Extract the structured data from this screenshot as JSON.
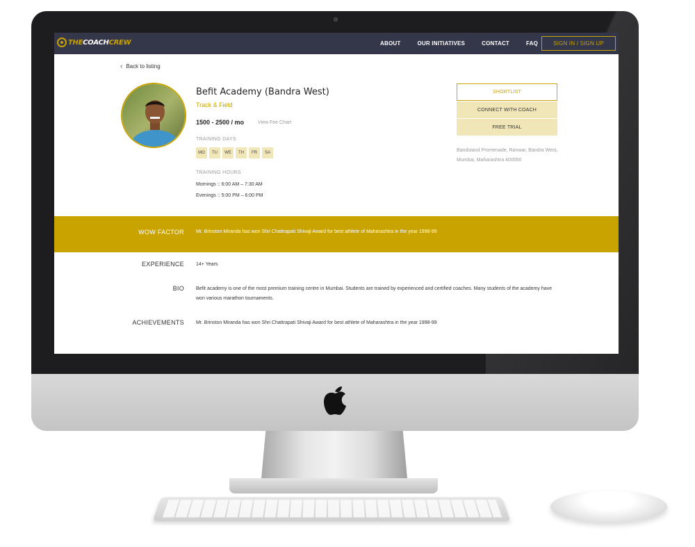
{
  "nav": {
    "logo_part1": "THE",
    "logo_part2": "COACH",
    "logo_part3": "CREW",
    "links": [
      "ABOUT",
      "OUR INITIATIVES",
      "CONTACT",
      "FAQ"
    ],
    "signin_label": "SIGN IN / SIGN UP"
  },
  "back_label": "Back to listing",
  "coach": {
    "title": "Befit Academy (Bandra West)",
    "sport": "Track & Field",
    "fee": "1500 - 2500 / mo",
    "fee_chart_label": "View Fee Chart",
    "training_days_label": "TRAINING DAYS",
    "days": [
      "MO",
      "TU",
      "WE",
      "TH",
      "FR",
      "SA"
    ],
    "training_hours_label": "TRAINING HOURS",
    "hours": [
      "Mornings :: 6:00 AM – 7:30 AM",
      "Evenings :: 5:00 PM – 6:00 PM"
    ]
  },
  "actions": {
    "shortlist": "SHORTLIST",
    "connect": "CONNECT WITH COACH",
    "trial": "FREE TRIAL"
  },
  "address": "Bandstand Promenade, Ranwar, Bandra West, Mumbai, Maharashtra 400050",
  "wow": {
    "label": "WOW FACTOR",
    "text": "Mr. Brinston Miranda has won Shri Chattrapati Shivaji Award for best athlete of Maharashtra in the year 1998-99"
  },
  "details": {
    "experience_label": "EXPERIENCE",
    "experience": "14+ Years",
    "bio_label": "BIO",
    "bio": "Befit academy is one of the most premium training centre in Mumbai. Students are trained by experienced and certified coaches. Many students of the academy have won various marathon tournaments.",
    "achievements_label": "ACHIEVEMENTS",
    "achievements": "Mr. Brinston Miranda has won Shri Chattrapati Shivaji Award for best athlete of Maharashtra in the year 1998-99"
  },
  "colors": {
    "accent": "#c9a300",
    "navbar": "#34364a",
    "pill": "#f1e6b8"
  }
}
